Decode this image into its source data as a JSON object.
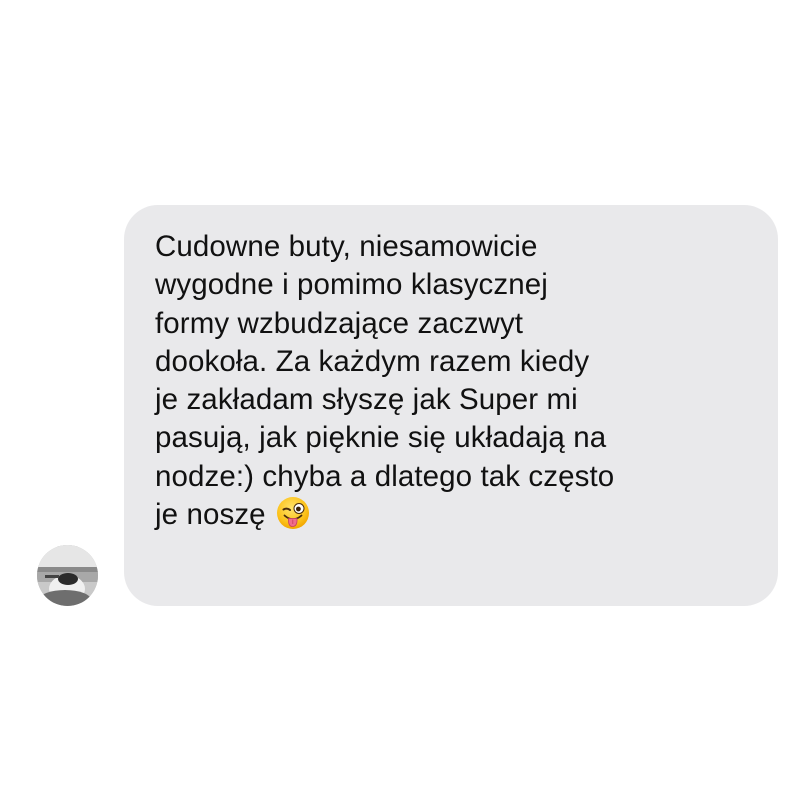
{
  "conversation": {
    "incoming_message": {
      "lines": [
        "Cudowne buty, niesamowicie",
        "wygodne i pomimo klasycznej",
        "formy wzbudzające zaczwyt",
        "dookoła. Za każdym razem kiedy",
        "je zakładam słyszę jak Super mi",
        "pasują, jak pięknie się układają na",
        "nodze:) chyba a dlatego tak często",
        "je noszę"
      ],
      "emoji": "winking-face-with-tongue"
    },
    "sender": {
      "avatar": "sender-avatar-photo"
    }
  },
  "colors": {
    "bubble_background": "#e9e9eb",
    "text": "#111111",
    "page_background": "#ffffff"
  }
}
